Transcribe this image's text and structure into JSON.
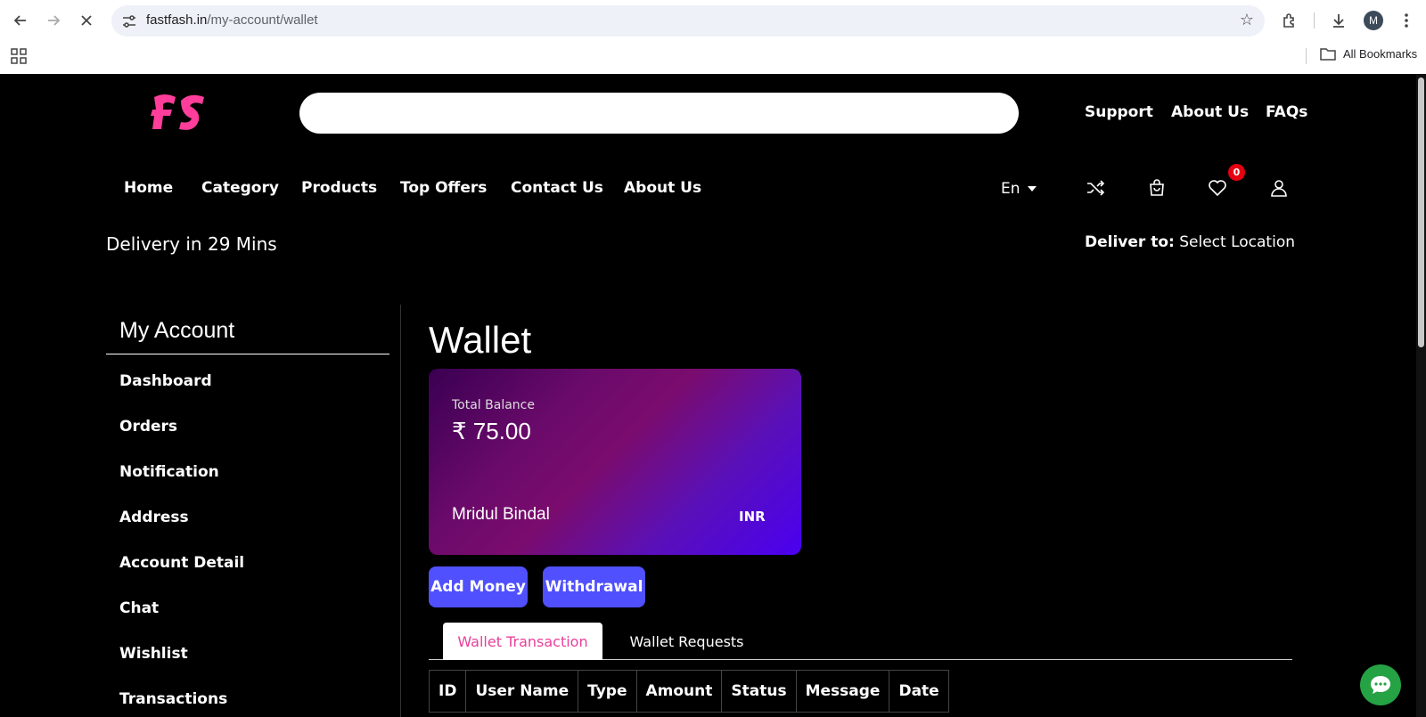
{
  "browser": {
    "url_host": "fastfash.in",
    "url_path": "/my-account/wallet",
    "avatar_letter": "M",
    "all_bookmarks": "All Bookmarks"
  },
  "header": {
    "search_placeholder": "",
    "links": [
      "Support",
      "About Us",
      "FAQs"
    ]
  },
  "nav": {
    "items": [
      "Home",
      "Category",
      "Products",
      "Top Offers",
      "Contact Us",
      "About Us"
    ],
    "language": "En",
    "wishlist_count": "0"
  },
  "delivery": {
    "eta": "Delivery in 29 Mins",
    "deliver_to_label": "Deliver to:",
    "deliver_to_value": "Select Location"
  },
  "sidebar": {
    "title": "My Account",
    "items": [
      "Dashboard",
      "Orders",
      "Notification",
      "Address",
      "Account Detail",
      "Chat",
      "Wishlist",
      "Transactions"
    ]
  },
  "wallet": {
    "title": "Wallet",
    "card": {
      "balance_label": "Total Balance",
      "balance": "₹ 75.00",
      "holder": "Mridul Bindal",
      "currency": "INR"
    },
    "buttons": {
      "add_money": "Add Money",
      "withdrawal": "Withdrawal"
    },
    "tabs": [
      "Wallet Transaction",
      "Wallet Requests"
    ],
    "table_headers": [
      "ID",
      "User Name",
      "Type",
      "Amount",
      "Status",
      "Message",
      "Date"
    ]
  },
  "colors": {
    "brand_pink": "#e8409a",
    "button_blue": "#5050ff",
    "badge_red": "#e60012",
    "chat_green": "#25a244"
  }
}
